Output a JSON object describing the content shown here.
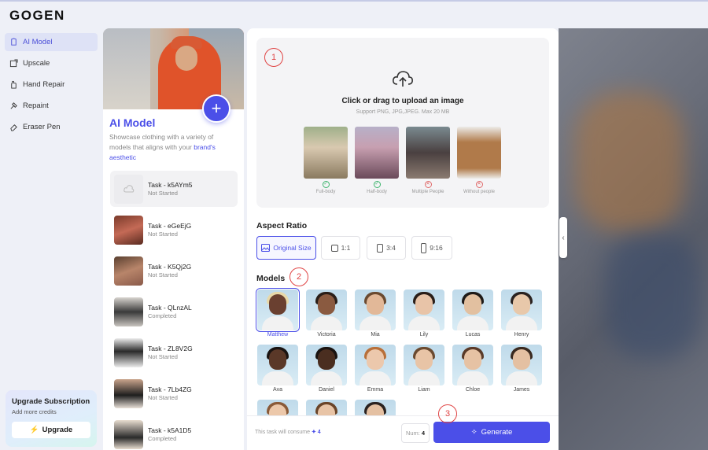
{
  "app": {
    "logo": "GOGEN"
  },
  "sidebar": {
    "items": [
      {
        "label": "AI Model",
        "icon": "ai-model-icon",
        "active": true
      },
      {
        "label": "Upscale",
        "icon": "upscale-icon"
      },
      {
        "label": "Hand Repair",
        "icon": "hand-icon"
      },
      {
        "label": "Repaint",
        "icon": "repaint-icon"
      },
      {
        "label": "Eraser Pen",
        "icon": "eraser-icon"
      }
    ],
    "upgrade": {
      "title": "Upgrade Subscription",
      "subtitle": "Add more credits",
      "button": "Upgrade"
    }
  },
  "left_panel": {
    "title": "AI Model",
    "description": "Showcase clothing with a variety of models that aligns with your ",
    "description_highlight": "brand's aesthetic",
    "tasks": [
      {
        "name": "Task - k5AYm5",
        "status": "Not Started"
      },
      {
        "name": "Task - eGeEjG",
        "status": "Not Started"
      },
      {
        "name": "Task - K5Qj2G",
        "status": "Not Started"
      },
      {
        "name": "Task - QLnzAL",
        "status": "Completed"
      },
      {
        "name": "Task - ZL8V2G",
        "status": "Not Started"
      },
      {
        "name": "Task - 7Lb4ZG",
        "status": "Not Started"
      },
      {
        "name": "Task - k5A1D5",
        "status": "Completed"
      }
    ]
  },
  "upload": {
    "title": "Click or drag to upload an image",
    "subtitle": "Support PNG, JPG,JPEG. Max 20 MB",
    "samples": [
      {
        "label": "Full-body",
        "ok": true
      },
      {
        "label": "Half-body",
        "ok": true
      },
      {
        "label": "Multiple People",
        "ok": false
      },
      {
        "label": "Without people",
        "ok": false
      }
    ]
  },
  "aspect_ratio": {
    "label": "Aspect Ratio",
    "options": [
      "Original Size",
      "1:1",
      "3:4",
      "9:16"
    ],
    "selected": "Original Size"
  },
  "models": {
    "label": "Models",
    "selected": "Matthew",
    "items": [
      "Matthew",
      "Victoria",
      "Mia",
      "Lily",
      "Lucas",
      "Henry",
      "Ava",
      "Daniel",
      "Emma",
      "Liam",
      "Chloe",
      "James"
    ]
  },
  "footer": {
    "consume_text": "This task will consume",
    "consume_value": "4",
    "num_label": "Num:",
    "num_value": "4",
    "generate": "Generate"
  },
  "annotations": [
    "1",
    "2",
    "3"
  ],
  "colors": {
    "accent": "#4b4fe8",
    "annotation": "#e04444"
  }
}
